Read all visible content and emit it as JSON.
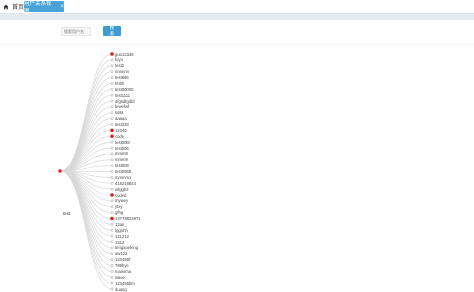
{
  "tabs": {
    "home_label": "首页",
    "active_label": "用户关系视图",
    "close_glyph": "×"
  },
  "search": {
    "placeholder": "搜索用户名",
    "button_label": "搜索"
  },
  "tree": {
    "root": "test",
    "root_color": "#e02020",
    "link_color": "#d8d8d8",
    "leaves": [
      {
        "label": "guo12345",
        "highlight": true
      },
      {
        "label": "fuyu",
        "highlight": false
      },
      {
        "label": "test2",
        "highlight": false
      },
      {
        "label": "nnnnnn",
        "highlight": false
      },
      {
        "label": "test666",
        "highlight": false
      },
      {
        "label": "hhhh",
        "highlight": false
      },
      {
        "label": "test00000",
        "highlight": false
      },
      {
        "label": "test1111",
        "highlight": false
      },
      {
        "label": "dfgsdfgdfd",
        "highlight": false
      },
      {
        "label": "fewefwf",
        "highlight": false
      },
      {
        "label": "ssss",
        "highlight": false
      },
      {
        "label": "aaaaa",
        "highlight": false
      },
      {
        "label": "test333",
        "highlight": false
      },
      {
        "label": "12345",
        "highlight": true
      },
      {
        "label": "code",
        "highlight": true
      },
      {
        "label": "test00l8",
        "highlight": false
      },
      {
        "label": "test006",
        "highlight": false
      },
      {
        "label": "mmm8",
        "highlight": false
      },
      {
        "label": "mmm9",
        "highlight": false
      },
      {
        "label": "test008",
        "highlight": false
      },
      {
        "label": "test0088",
        "highlight": false
      },
      {
        "label": "mmmm1",
        "highlight": false
      },
      {
        "label": "418318844",
        "highlight": false
      },
      {
        "label": "wfggh3",
        "highlight": false
      },
      {
        "label": "coded",
        "highlight": true
      },
      {
        "label": "mywey",
        "highlight": false
      },
      {
        "label": "ytxy",
        "highlight": false
      },
      {
        "label": "gfhg",
        "highlight": false
      },
      {
        "label": "13778823971",
        "highlight": true
      },
      {
        "label": "12an_",
        "highlight": false
      },
      {
        "label": "fggnhh",
        "highlight": false
      },
      {
        "label": "121212",
        "highlight": false
      },
      {
        "label": "1312",
        "highlight": false
      },
      {
        "label": "tengxuefeng",
        "highlight": false
      },
      {
        "label": "aw123",
        "highlight": false
      },
      {
        "label": "123456f",
        "highlight": false
      },
      {
        "label": "789hye",
        "highlight": false
      },
      {
        "label": "mamima",
        "highlight": false
      },
      {
        "label": "waee",
        "highlight": false
      },
      {
        "label": "123456bm",
        "highlight": false
      },
      {
        "label": "duang",
        "highlight": false
      }
    ]
  }
}
